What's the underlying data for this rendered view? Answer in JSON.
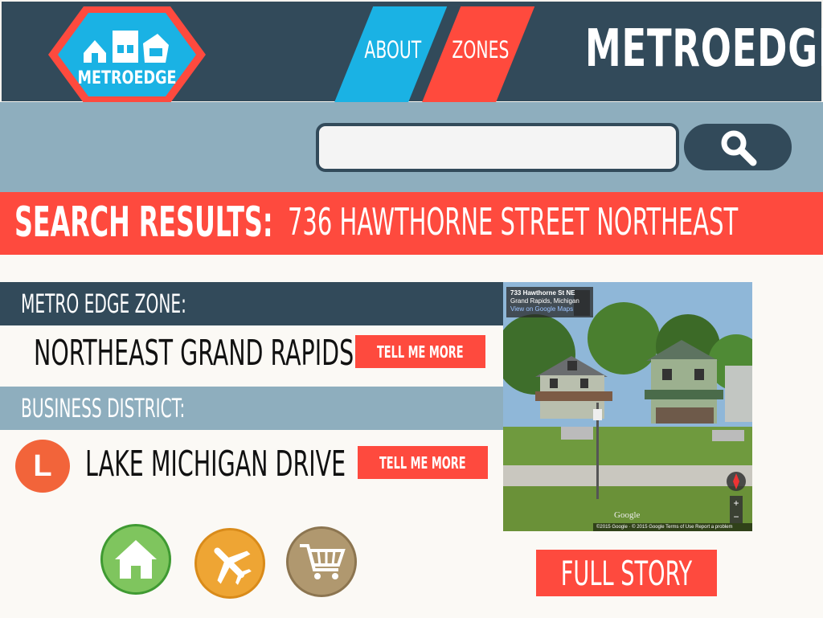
{
  "header": {
    "logo_text": "METROEDGE",
    "nav": [
      {
        "label": "ABOUT"
      },
      {
        "label": "ZONES"
      }
    ],
    "brand": "METROEDGE"
  },
  "search": {
    "value": "",
    "placeholder": ""
  },
  "results": {
    "label": "SEARCH RESULTS:",
    "address": "736 HAWTHORNE STREET NORTHEAST"
  },
  "zone": {
    "label": "METRO EDGE ZONE:",
    "value": "NORTHEAST GRAND RAPIDS",
    "button": "TELL ME MORE"
  },
  "district": {
    "label": "BUSINESS DISTRICT:",
    "badge": "L",
    "value": "LAKE MICHIGAN DRIVE",
    "button": "TELL ME MORE"
  },
  "categories": [
    {
      "name": "home",
      "icon": "home-icon",
      "color": "#7fc55e"
    },
    {
      "name": "travel",
      "icon": "airplane-icon",
      "color": "#eea534"
    },
    {
      "name": "shopping",
      "icon": "shopping-cart-icon",
      "color": "#b0986f"
    }
  ],
  "photo": {
    "caption_line1": "733 Hawthorne St NE",
    "caption_line2": "Grand Rapids, Michigan",
    "caption_line3": "View on Google Maps",
    "google_mark": "Google",
    "footer": "©2015 Google · © 2015 Google   Terms of Use   Report a problem"
  },
  "full_story": "FULL STORY",
  "colors": {
    "navy": "#324a5a",
    "sky": "#8eaebe",
    "red": "#fe4a3e",
    "cyan": "#1ab2e4"
  }
}
